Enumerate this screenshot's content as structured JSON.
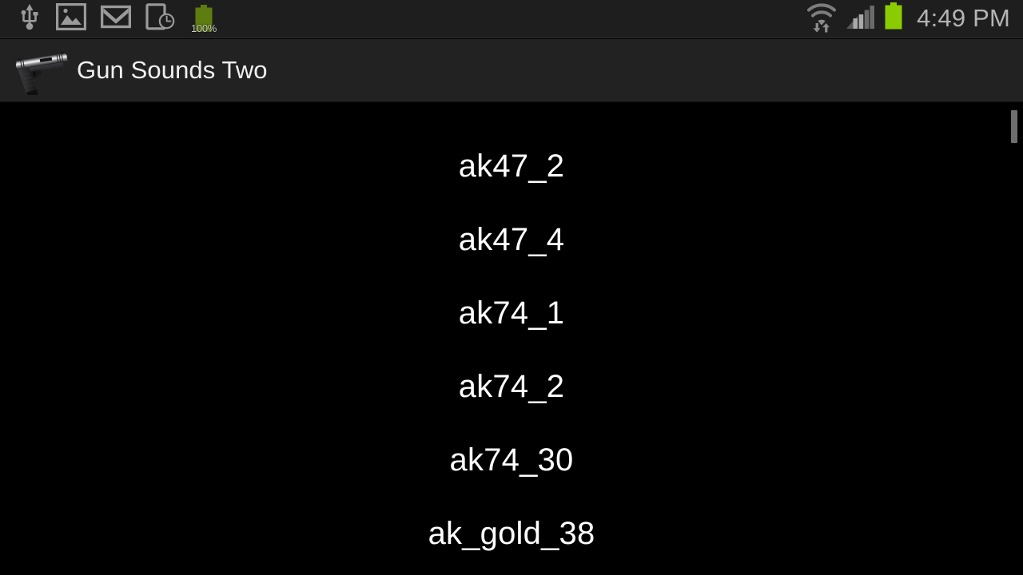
{
  "status_bar": {
    "background_color": "#1e1e1e",
    "time": "4:49 PM",
    "left_icons": [
      {
        "name": "usb-icon",
        "label": "USB connected"
      },
      {
        "name": "gallery-icon",
        "label": "Screenshot captured"
      },
      {
        "name": "gmail-icon",
        "label": "New Gmail message"
      },
      {
        "name": "device-clock-icon",
        "label": "Alarm / scheduled"
      }
    ],
    "battery_small": {
      "name": "battery-charge-icon",
      "percent_label": "100%",
      "color": "#5e7d10"
    },
    "right_icons": [
      {
        "name": "wifi-transfer-icon",
        "label": "Wi-Fi with data transfer"
      },
      {
        "name": "cellular-signal-icon",
        "label": "Cellular signal",
        "bars_total": 4,
        "bars_active": 2
      },
      {
        "name": "battery-icon",
        "label": "Battery full",
        "color": "#8bcc00"
      }
    ]
  },
  "action_bar": {
    "background_color": "#222222",
    "icon_name": "pistol-icon",
    "title": "Gun Sounds Two"
  },
  "list": {
    "background_color": "#000000",
    "text_color": "#ffffff",
    "items": [
      {
        "label": "_",
        "partial": true
      },
      {
        "label": "ak47_2",
        "partial": false
      },
      {
        "label": "ak47_4",
        "partial": false
      },
      {
        "label": "ak74_1",
        "partial": false
      },
      {
        "label": "ak74_2",
        "partial": false
      },
      {
        "label": "ak74_30",
        "partial": false
      },
      {
        "label": "ak_gold_38",
        "partial": false
      }
    ]
  },
  "scrollbar": {
    "name": "vertical-scrollbar",
    "color": "#6e6e6e"
  }
}
